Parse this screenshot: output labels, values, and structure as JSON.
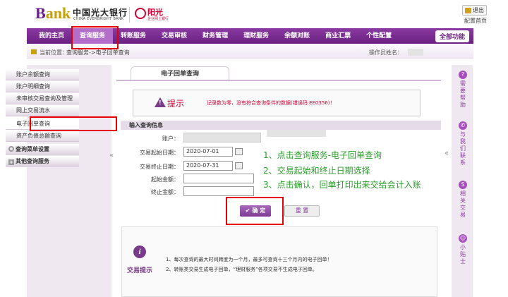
{
  "header": {
    "logo_prefix": "B",
    "logo_word": "ank",
    "bank_name_cn": "中国光大银行",
    "bank_name_en": "CHINA EVERBRIGHT BANK",
    "sub_brand": "阳光",
    "sub_brand_caption": "企业网上银行",
    "exit_label": "退出",
    "homepage_label": "配置首页"
  },
  "nav": {
    "items": [
      "我的主页",
      "查询服务",
      "转账服务",
      "交易审核",
      "财务管理",
      "理财服务",
      "余额对账",
      "商业汇票",
      "个性配置"
    ],
    "all_label": "全部功能"
  },
  "breadcrumb": {
    "label": "当前位置：",
    "path": "查询服务->电子回单查询",
    "operator_label": "操作员姓名："
  },
  "sidebar": {
    "items": [
      "账户余额查询",
      "账户明细查询",
      "未审核交易查询及管理",
      "网上交易流水",
      "电子回单查询",
      "资产负债总额查询"
    ],
    "groups": [
      "查询菜单设置",
      "其他查询服务"
    ]
  },
  "main": {
    "tab_label": "电子回单查询",
    "tip_title": "提示",
    "tip_message": "记录数为零，没有符合查询条件的数据(错误码:EE0356)！",
    "section_title": "输入查询信息",
    "fields": {
      "account_label": "账户：",
      "start_label": "交易起始日期：",
      "start_value": "2020-07-01",
      "end_label": "交易终止日期：",
      "end_value": "2020-07-31",
      "min_amount_label": "起始金额：",
      "max_amount_label": "终止金额："
    },
    "confirm_label": "确 定",
    "reset_label": "重 置",
    "note_title": "交易提示",
    "notes": [
      "1、每次查询的最大时间跨度为一个月，最多可查询十三个月内的电子回单！",
      "2、转账类交易生成电子回单，“理财服务”各项交易不生成电子回单。"
    ]
  },
  "annotations": [
    "1、点击查询服务-电子回单查询",
    "2、交易起始和终止日期选择",
    "3、点击确认，回单打印出来交给会计入账"
  ],
  "rail": {
    "items": [
      "需要帮助",
      "与我们联系",
      "相关交易",
      "小贴士"
    ],
    "icons": [
      "?",
      "✆",
      "S",
      "☺"
    ]
  },
  "colors": {
    "brand_purple": "#6a2080",
    "annotation_green": "#2a9d2a",
    "highlight_red": "#e60000",
    "error_red": "#cc0033"
  }
}
